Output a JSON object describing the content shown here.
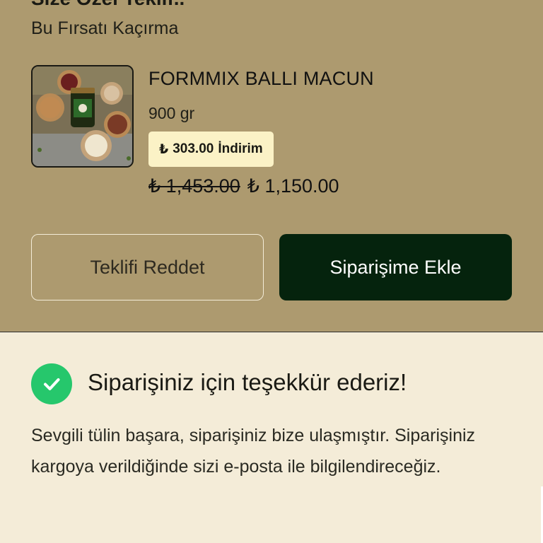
{
  "offer": {
    "title": "Size Özel Teklif..",
    "subtitle": "Bu Fırsatı Kaçırma",
    "product": {
      "image_icon": "product-photo",
      "name": "FORMMIX BALLI MACUN",
      "weight": "900 gr",
      "discount": {
        "currency": "₺",
        "amount": "303.00",
        "label": "İndirim"
      },
      "price_old": "₺ 1,453.00",
      "price_new": "₺ 1,150.00"
    },
    "reject_label": "Teklifi Reddet",
    "add_label": "Siparişime Ekle"
  },
  "thanks": {
    "icon": "check-circle-icon",
    "title": "Siparişiniz için teşekkür ederiz!",
    "body": "Sevgili tülin başara, siparişiniz bize ulaşmıştır. Siparişiniz kargoya verildiğinde sizi e-posta ile bilgilendireceğiz."
  },
  "colors": {
    "offer_bg": "#ad9a6f",
    "page_bg": "#f4ecd8",
    "primary_button": "#05230d",
    "badge_bg": "#fbf2c6",
    "success": "#26c76c"
  }
}
